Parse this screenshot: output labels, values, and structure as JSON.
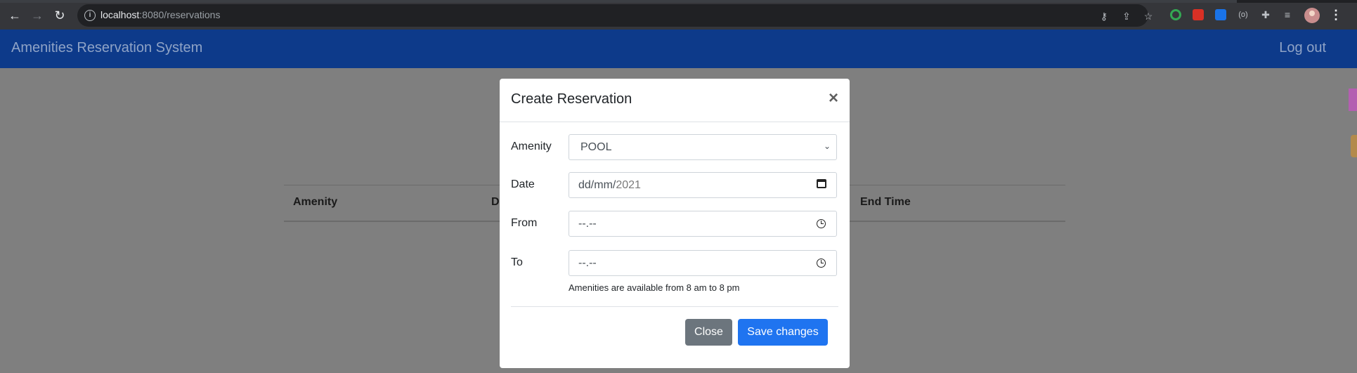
{
  "browser": {
    "url_host": "localhost",
    "url_rest": ":8080/reservations",
    "extension_colors": [
      "#34a853",
      "#d93025",
      "#1a73e8",
      "#8ab4f8"
    ]
  },
  "navbar": {
    "brand": "Amenities Reservation System",
    "logout": "Log out"
  },
  "table": {
    "headers": [
      "Amenity",
      "D",
      "End Time"
    ]
  },
  "modal": {
    "title": "Create Reservation",
    "close_symbol": "×",
    "fields": {
      "amenity": {
        "label": "Amenity",
        "value": "POOL"
      },
      "date": {
        "label": "Date",
        "value_prefix": "dd/mm/",
        "value_year": "2021"
      },
      "from": {
        "label": "From",
        "value": "--.--"
      },
      "to": {
        "label": "To",
        "value": "--.--"
      }
    },
    "help_text": "Amenities are available from 8 am to 8 pm",
    "buttons": {
      "close": "Close",
      "save": "Save changes"
    }
  }
}
